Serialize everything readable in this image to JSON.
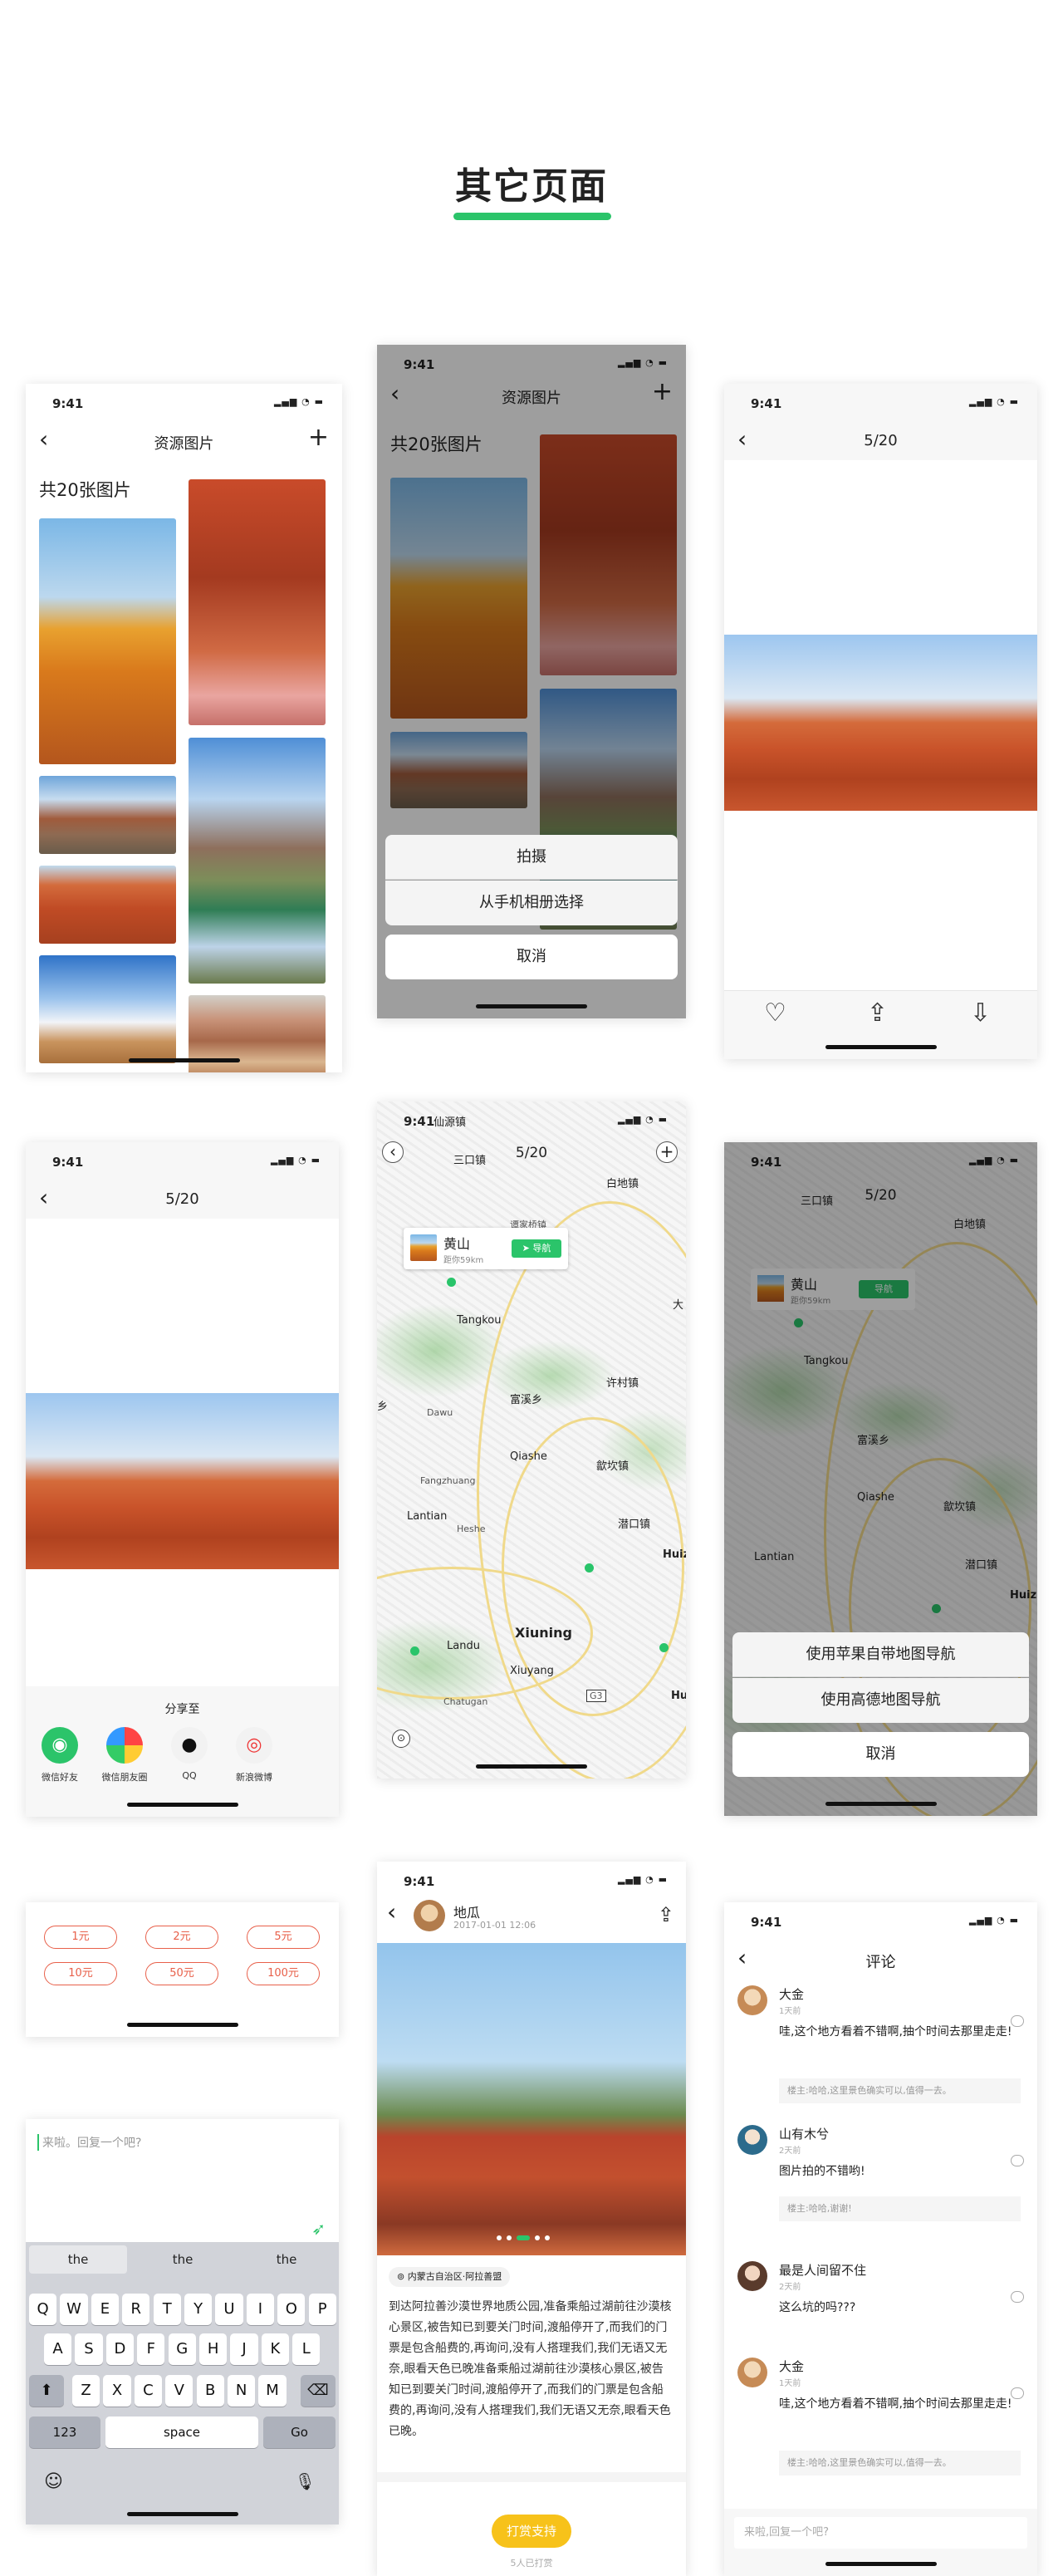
{
  "page_title": "其它页面",
  "status_time": "9:41",
  "album": {
    "title": "资源图片",
    "count_text": "共20张图片"
  },
  "action_sheet": {
    "take_photo": "拍摄",
    "choose_album": "从手机相册选择",
    "cancel": "取消"
  },
  "viewer": {
    "counter": "5/20"
  },
  "share": {
    "title": "分享至",
    "items": [
      "微信好友",
      "微信朋友圈",
      "QQ",
      "新浪微博"
    ]
  },
  "map": {
    "counter": "5/20",
    "place_name": "黄山",
    "place_distance": "距你59km",
    "nav_button": "导航",
    "labels": [
      "仙源镇",
      "三口镇",
      "白地镇",
      "谭家桥镇",
      "Tangkou",
      "许村镇",
      "富溪乡",
      "Dawu",
      "Qiashe",
      "Fangzhuang",
      "歙坎镇",
      "Lantian",
      "Heshe",
      "潜口镇",
      "Huiz",
      "Xiuning",
      "Landu",
      "Xiuyang",
      "Chatugan",
      "G3",
      "大",
      "乡",
      "Hu"
    ],
    "nav_apple": "使用苹果自带地图导航",
    "nav_amap": "使用高德地图导航",
    "cancel": "取消"
  },
  "reward": {
    "amounts": [
      "1元",
      "2元",
      "5元",
      "10元",
      "50元",
      "100元"
    ]
  },
  "reply_box": {
    "placeholder": "来啦。回复一个吧?"
  },
  "keyboard": {
    "suggestions": [
      "the",
      "the",
      "the"
    ],
    "row1": [
      "Q",
      "W",
      "E",
      "R",
      "T",
      "Y",
      "U",
      "I",
      "O",
      "P"
    ],
    "row2": [
      "A",
      "S",
      "D",
      "F",
      "G",
      "H",
      "J",
      "K",
      "L"
    ],
    "row3": [
      "Z",
      "X",
      "C",
      "V",
      "B",
      "N",
      "M"
    ],
    "num": "123",
    "space": "space",
    "go": "Go"
  },
  "post": {
    "author": "地瓜",
    "date": "2017-01-01 12:06",
    "location": "内蒙古自治区·阿拉善盟",
    "body": "到达阿拉善沙漠世界地质公园,准备乘船过湖前往沙漠核心景区,被告知已到要关门时间,渡船停开了,而我们的门票是包含船费的,再询问,没有人搭理我们,我们无语又无奈,眼看天色已晚准备乘船过湖前往沙漠核心景区,被告知已到要关门时间,渡船停开了,而我们的门票是包含船费的,再询问,没有人搭理我们,我们无语又无奈,眼看天色已晚。",
    "tip_button": "打赏支持",
    "tip_count": "5人已打赏"
  },
  "comments": {
    "title": "评论",
    "items": [
      {
        "name": "大金",
        "ago": "1天前",
        "text": "哇,这个地方看着不错啊,抽个时间去那里走走!",
        "reply": "楼主:哈哈,这里景色确实可以,值得一去。"
      },
      {
        "name": "山有木兮",
        "ago": "2天前",
        "text": "图片拍的不错哟!",
        "reply": "楼主:哈哈,谢谢!"
      },
      {
        "name": "最是人间留不住",
        "ago": "2天前",
        "text": "这么坑的吗???",
        "reply": ""
      },
      {
        "name": "大金",
        "ago": "1天前",
        "text": "哇,这个地方看着不错啊,抽个时间去那里走走!",
        "reply": "楼主:哈哈,这里景色确实可以,值得一去。"
      }
    ],
    "input_placeholder": "来啦,回复一个吧?"
  },
  "colors": {
    "accent_green": "#2bc46a",
    "reward_red": "#e8604a",
    "tip_yellow": "#f7c21a"
  }
}
